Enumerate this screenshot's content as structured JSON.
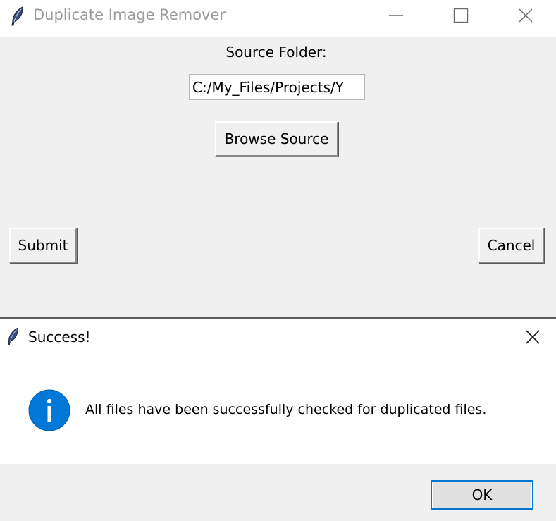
{
  "main_window": {
    "title": "Duplicate Image Remover",
    "app_icon": "feather-icon",
    "controls": {
      "minimize_icon": "minimize-icon",
      "maximize_icon": "maximize-icon",
      "close_icon": "close-icon"
    },
    "source_label": "Source Folder:",
    "source_value": "C:/My_Files/Projects/Y",
    "browse_button": "Browse Source",
    "submit_button": "Submit",
    "cancel_button": "Cancel"
  },
  "dialog": {
    "title": "Success!",
    "app_icon": "feather-icon",
    "close_icon": "close-icon",
    "info_icon": "info-icon",
    "message": "All files have been successfully checked for duplicated files.",
    "ok_button": "OK"
  },
  "colors": {
    "window_bg": "#f0f0f0",
    "titlebar_bg": "#ffffff",
    "info_blue": "#0078d7",
    "focus_border": "#0078d7"
  }
}
